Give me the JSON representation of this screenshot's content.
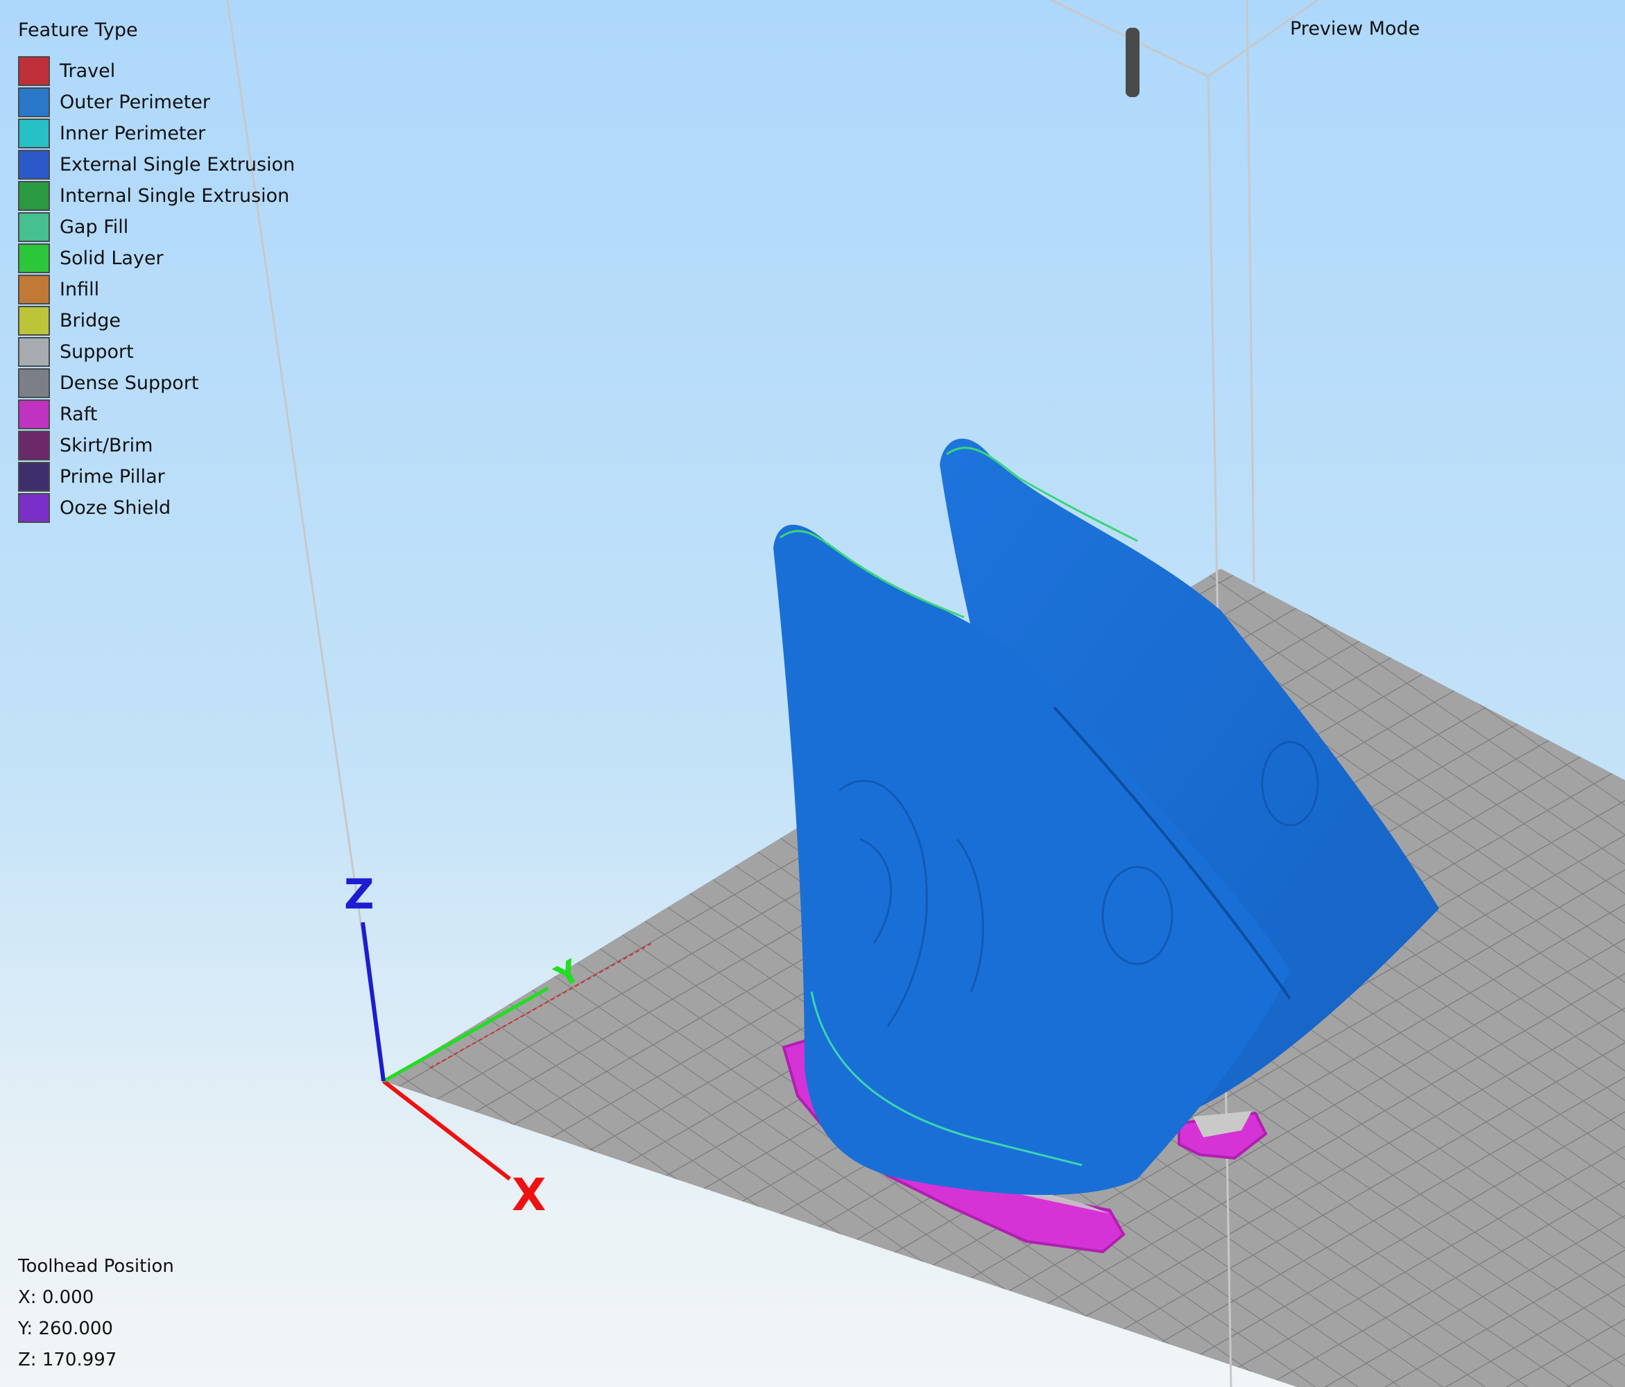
{
  "legend": {
    "title": "Feature Type",
    "items": [
      {
        "label": "Travel",
        "color": "#c0303a"
      },
      {
        "label": "Outer Perimeter",
        "color": "#2a79c8"
      },
      {
        "label": "Inner Perimeter",
        "color": "#26c0c6"
      },
      {
        "label": "External Single Extrusion",
        "color": "#2b59c8"
      },
      {
        "label": "Internal Single Extrusion",
        "color": "#2a9a40"
      },
      {
        "label": "Gap Fill",
        "color": "#46c08e"
      },
      {
        "label": "Solid Layer",
        "color": "#2cc63a"
      },
      {
        "label": "Infill",
        "color": "#c07a36"
      },
      {
        "label": "Bridge",
        "color": "#bcc43a"
      },
      {
        "label": "Support",
        "color": "#a6acb0"
      },
      {
        "label": "Dense Support",
        "color": "#7b8088"
      },
      {
        "label": "Raft",
        "color": "#c033c0"
      },
      {
        "label": "Skirt/Brim",
        "color": "#6a2a6a"
      },
      {
        "label": "Prime Pillar",
        "color": "#3e2e6c"
      },
      {
        "label": "Ooze Shield",
        "color": "#7a30c8"
      }
    ]
  },
  "preview_mode_label": "Preview Mode",
  "axes": {
    "x_label": "X",
    "y_label": "Y",
    "z_label": "Z"
  },
  "toolhead": {
    "title": "Toolhead Position",
    "x": "X: 0.000",
    "y": "Y: 260.000",
    "z": "Z: 170.997"
  },
  "colors": {
    "model": "#1a6fd6",
    "bed": "#9c9c9c",
    "raft": "#d633d6",
    "axis_x": "#ee1111",
    "axis_y": "#22dd22",
    "axis_z": "#1c1cd0"
  }
}
